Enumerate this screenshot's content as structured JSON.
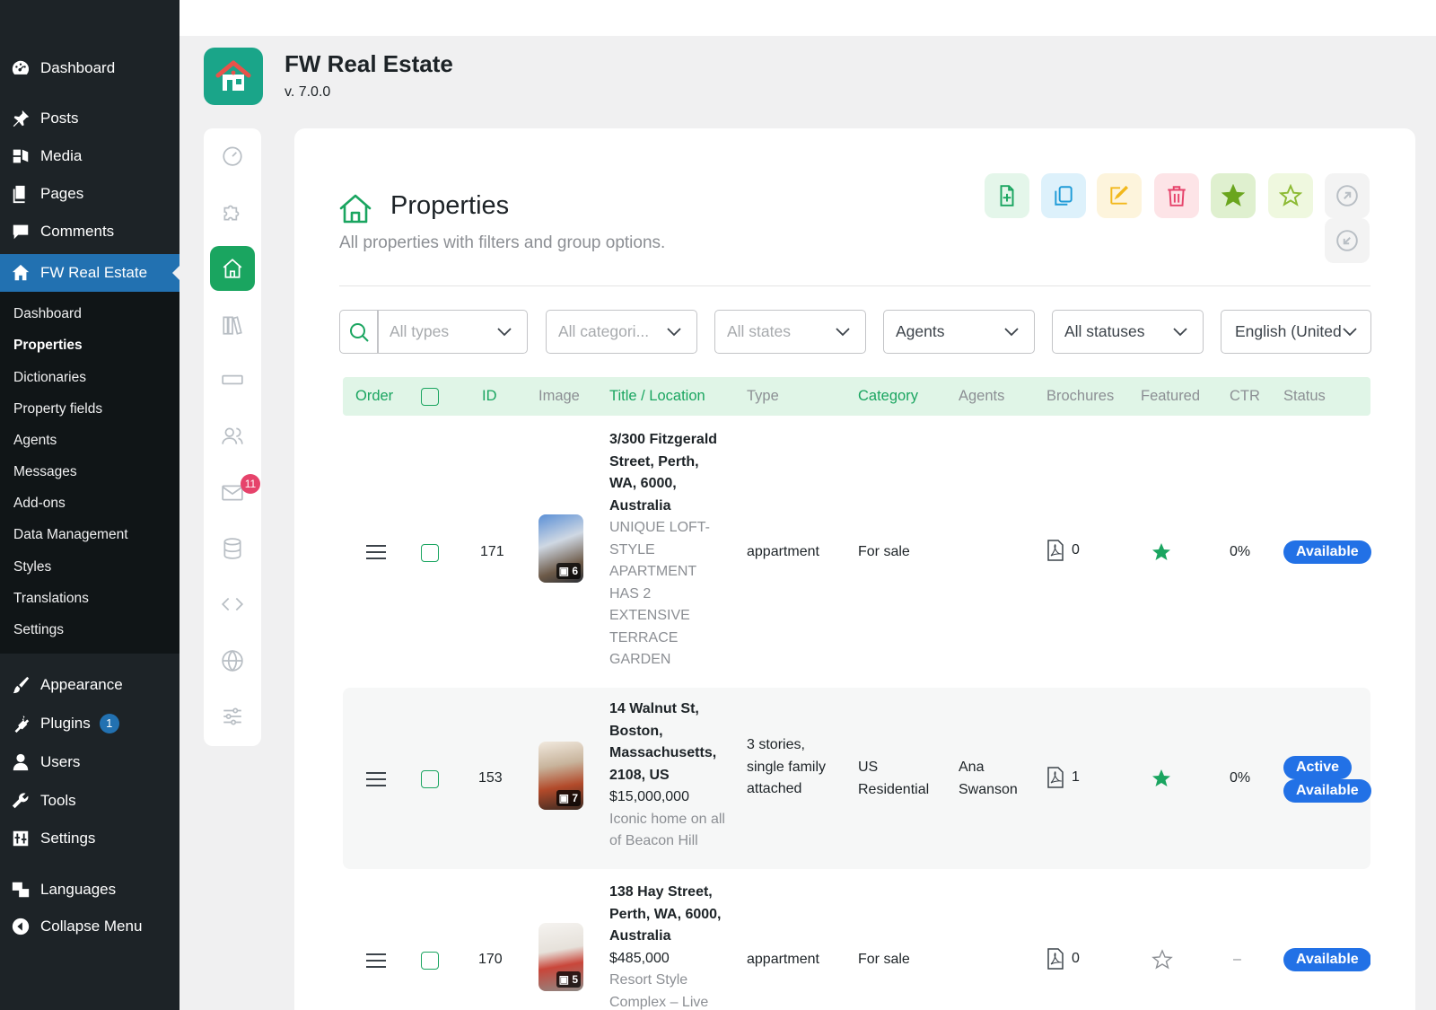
{
  "wp_menu": {
    "items": [
      {
        "label": "Dashboard",
        "icon": "dashboard-icon"
      },
      {
        "label": "Posts",
        "icon": "pin-icon"
      },
      {
        "label": "Media",
        "icon": "media-icon"
      },
      {
        "label": "Pages",
        "icon": "pages-icon"
      },
      {
        "label": "Comments",
        "icon": "comment-icon"
      },
      {
        "label": "FW Real Estate",
        "icon": "home-icon"
      },
      {
        "label": "Appearance",
        "icon": "brush-icon"
      },
      {
        "label": "Plugins",
        "icon": "plugin-icon",
        "badge": "1"
      },
      {
        "label": "Users",
        "icon": "user-icon"
      },
      {
        "label": "Tools",
        "icon": "wrench-icon"
      },
      {
        "label": "Settings",
        "icon": "settings-icon"
      },
      {
        "label": "Languages",
        "icon": "translate-icon"
      },
      {
        "label": "Collapse Menu",
        "icon": "collapse-icon"
      }
    ],
    "submenu": [
      "Dashboard",
      "Properties",
      "Dictionaries",
      "Property fields",
      "Agents",
      "Messages",
      "Add-ons",
      "Data Management",
      "Styles",
      "Translations",
      "Settings"
    ]
  },
  "app": {
    "title": "FW Real Estate",
    "version": "v. 7.0.0"
  },
  "side_nav": {
    "messages_badge": "11"
  },
  "page": {
    "title": "Properties",
    "subtitle": "All properties with filters and group options."
  },
  "filters": {
    "types": "All types",
    "categories": "All categori...",
    "states": "All states",
    "agents": "Agents",
    "statuses": "All statuses",
    "language": "English (United"
  },
  "table": {
    "headers": {
      "order": "Order",
      "id": "ID",
      "image": "Image",
      "title": "Title / Location",
      "type": "Type",
      "category": "Category",
      "agents": "Agents",
      "brochures": "Brochures",
      "featured": "Featured",
      "ctr": "CTR",
      "status": "Status"
    },
    "rows": [
      {
        "id": "171",
        "location": "3/300 Fitzgerald Street, Perth, WA, 6000, Australia",
        "price": "",
        "description": "UNIQUE LOFT-STYLE APARTMENT HAS 2 EXTENSIVE TERRACE GARDEN",
        "image_count": "6",
        "type": "appartment",
        "category": "For sale",
        "agents": "",
        "brochures": "0",
        "featured": true,
        "ctr": "0%",
        "statuses": [
          "Available"
        ]
      },
      {
        "id": "153",
        "location": "14 Walnut St, Boston, Massachusetts, 2108, US",
        "price": "$15,000,000",
        "description": "Iconic home on all of Beacon Hill",
        "image_count": "7",
        "type": "3 stories, single family attached",
        "category": "US Residential",
        "agents": "Ana Swanson",
        "brochures": "1",
        "featured": true,
        "ctr": "0%",
        "statuses": [
          "Active",
          "Available"
        ]
      },
      {
        "id": "170",
        "location": "138 Hay Street, Perth, WA, 6000, Australia",
        "price": "$485,000",
        "description": "Resort Style Complex – Live",
        "image_count": "5",
        "type": "appartment",
        "category": "For sale",
        "agents": "",
        "brochures": "0",
        "featured": false,
        "ctr": "–",
        "statuses": [
          "Available"
        ]
      }
    ]
  },
  "colors": {
    "accent_green": "#1aa560",
    "wp_blue": "#2271b1",
    "status_blue": "#2271e6"
  }
}
